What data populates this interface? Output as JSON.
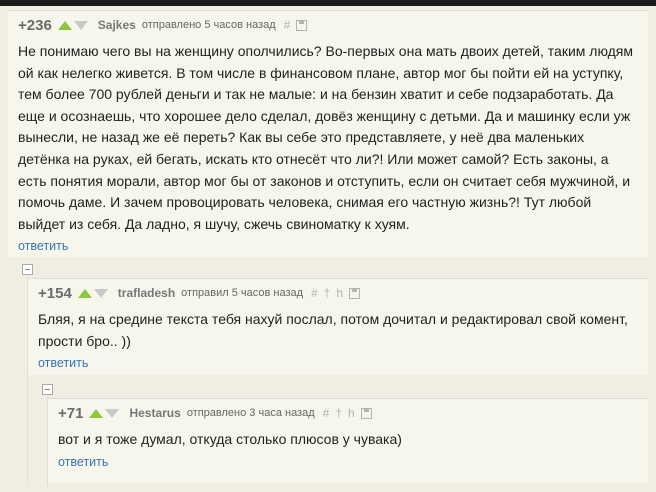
{
  "comments": [
    {
      "rating": "+236",
      "author": "Sajkes",
      "meta": "отправлено 5 часов назад",
      "tools": [
        "#"
      ],
      "text": "Не понимаю чего вы на женщину ополчились? Во-первых она мать двоих детей, таким людям ой как нелегко живется. В том числе в финансовом плане, автор мог бы пойти ей на уступку, тем более 700 рублей деньги и так не малые: и на бензин хватит и себе подзаработать. Да еще и осознаешь, что хорошее дело сделал, довёз женщину с детьми. Да и машинку если уж вынесли, не назад же её переть? Как вы себе это представляете, у неё два маленьких детёнка на руках, ей бегать, искать кто отнесёт что ли?! Или может самой? Есть законы, а есть понятия морали, автор мог бы от законов и отступить, если он считает себя мужчиной, и помочь даме. И зачем провоцировать человека, снимая его частную жизнь?! Тут любой выйдет из себя. Да ладно, я шучу, сжечь свиноматку к хуям.",
      "reply": "ответить"
    },
    {
      "rating": "+154",
      "author": "trafladesh",
      "meta": "отправил 5 часов назад",
      "tools": [
        "#",
        "†",
        "h"
      ],
      "text": "Бляя, я на средине текста тебя нахуй послал, потом дочитал и редактировал свой комент, прости бро.. ))",
      "reply": "ответить"
    },
    {
      "rating": "+71",
      "author": "Hestarus",
      "meta": "отправлено 3 часа назад",
      "tools": [
        "#",
        "†",
        "h"
      ],
      "text": "вот и я тоже думал, откуда столько плюсов у чувака)",
      "reply": "ответить"
    }
  ],
  "colors": {
    "vote_up": "#8dc63f",
    "vote_down": "#c9c9c9",
    "link": "#3a74b2",
    "background": "#f0eee3"
  }
}
